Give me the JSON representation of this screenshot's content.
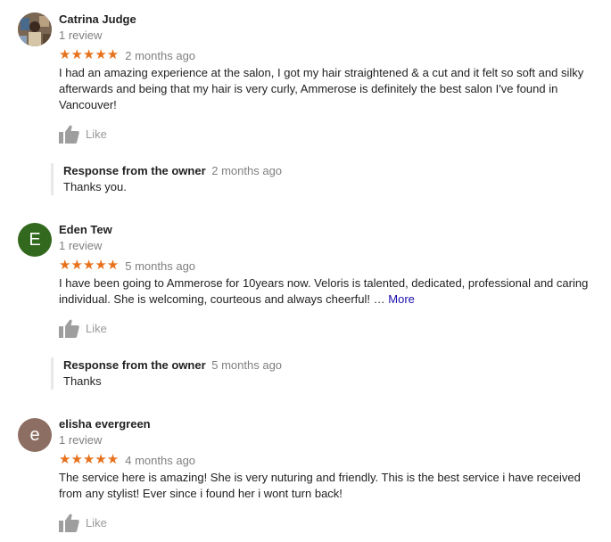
{
  "reviews": [
    {
      "name": "Catrina Judge",
      "review_count": "1 review",
      "stars": "★★★★★",
      "rating": 5,
      "date": "2 months ago",
      "text": "I had an amazing experience at the salon, I got my hair straightened & a cut and it felt so soft and silky afterwards and being that my hair is very curly, Ammerose is definitely the best salon I've found in Vancouver!",
      "like_label": "Like",
      "owner_title": "Response from the owner",
      "owner_date": "2 months ago",
      "owner_text": "Thanks you."
    },
    {
      "name": "Eden Tew",
      "avatar_letter": "E",
      "avatar_color": "#33691e",
      "review_count": "1 review",
      "stars": "★★★★★",
      "rating": 5,
      "date": "5 months ago",
      "text": "I have been going to Ammerose for 10years now. Veloris is talented, dedicated, professional and caring individual. She is welcoming, courteous and always cheerful! …",
      "more_label": "More",
      "like_label": "Like",
      "owner_title": "Response from the owner",
      "owner_date": "5 months ago",
      "owner_text": "Thanks"
    },
    {
      "name": "elisha evergreen",
      "avatar_letter": "e",
      "avatar_color": "#8d6e63",
      "review_count": "1 review",
      "stars": "★★★★★",
      "rating": 5,
      "date": "4 months ago",
      "text": "The service here is amazing! She is very nuturing and friendly. This is the best service i have received from any stylist! Ever since i found her i wont turn back!",
      "like_label": "Like"
    }
  ],
  "colors": {
    "star": "#e7711b",
    "link": "#1a0dab",
    "muted": "#808080",
    "like": "#999999"
  }
}
